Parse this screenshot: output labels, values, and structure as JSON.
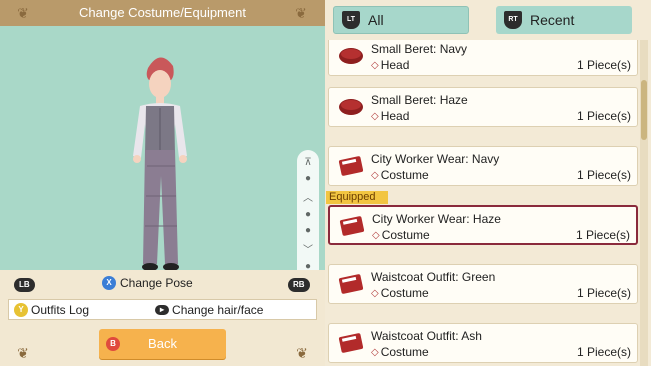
{
  "left": {
    "title": "Change Costume/Equipment",
    "buttons": {
      "lb": "LB",
      "rb": "RB",
      "pose_key": "X",
      "pose_label": "Change Pose",
      "outfits_key": "Y",
      "outfits_label": "Outfits Log",
      "hair_label": "Change hair/face",
      "back_key": "B",
      "back_label": "Back"
    },
    "colors": {
      "viewport_bg": "#a9d8c8",
      "back_button": "#f6b24d"
    }
  },
  "right": {
    "tabs": [
      {
        "key": "LT",
        "label": "All"
      },
      {
        "key": "RT",
        "label": "Recent"
      }
    ],
    "equipped_label": "Equipped",
    "items": [
      {
        "name": "Small Beret: Navy",
        "category": "Head",
        "count": "1 Piece(s)",
        "icon": "beret-icon"
      },
      {
        "name": "Small Beret: Haze",
        "category": "Head",
        "count": "1 Piece(s)",
        "icon": "beret-icon"
      },
      {
        "name": "City Worker Wear: Navy",
        "category": "Costume",
        "count": "1 Piece(s)",
        "icon": "costume-book-icon"
      },
      {
        "name": "City Worker Wear: Haze",
        "category": "Costume",
        "count": "1 Piece(s)",
        "icon": "costume-book-icon",
        "equipped": true
      },
      {
        "name": "Waistcoat Outfit: Green",
        "category": "Costume",
        "count": "1 Piece(s)",
        "icon": "costume-book-icon"
      },
      {
        "name": "Waistcoat Outfit: Ash",
        "category": "Costume",
        "count": "1 Piece(s)",
        "icon": "costume-book-icon"
      }
    ]
  }
}
